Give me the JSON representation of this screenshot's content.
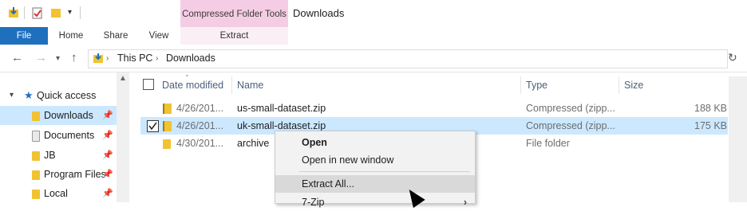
{
  "titlebar": {
    "contextual_tab": "Compressed Folder Tools",
    "window_title": "Downloads"
  },
  "ribbon_tabs": [
    "File",
    "Home",
    "Share",
    "View"
  ],
  "contextual_subtab": "Extract",
  "address": {
    "crumbs": [
      "This PC",
      "Downloads"
    ]
  },
  "sidebar": {
    "quick_access": "Quick access",
    "items": [
      {
        "label": "Downloads",
        "icon": "download-folder-icon",
        "selected": true
      },
      {
        "label": "Documents",
        "icon": "documents-icon"
      },
      {
        "label": "JB",
        "icon": "folder-icon"
      },
      {
        "label": "Program Files",
        "icon": "folder-icon"
      },
      {
        "label": "Local",
        "icon": "folder-icon"
      }
    ]
  },
  "columns": [
    "Date modified",
    "Name",
    "Type",
    "Size"
  ],
  "files": [
    {
      "date": "4/26/201...",
      "name": "us-small-dataset.zip",
      "type": "Compressed (zipp...",
      "size": "188 KB",
      "selected": false
    },
    {
      "date": "4/26/201...",
      "name": "uk-small-dataset.zip",
      "type": "Compressed (zipp...",
      "size": "175 KB",
      "selected": true
    },
    {
      "date": "4/30/201...",
      "name": "archive",
      "type": "File folder",
      "size": "",
      "selected": false
    }
  ],
  "context_menu": {
    "open": "Open",
    "open_new": "Open in new window",
    "extract_all": "Extract All...",
    "seven_zip": "7-Zip"
  },
  "colors": {
    "file_tab": "#1e6fbe",
    "contextual_tab": "#f4cde4",
    "selection": "#cce8ff"
  }
}
